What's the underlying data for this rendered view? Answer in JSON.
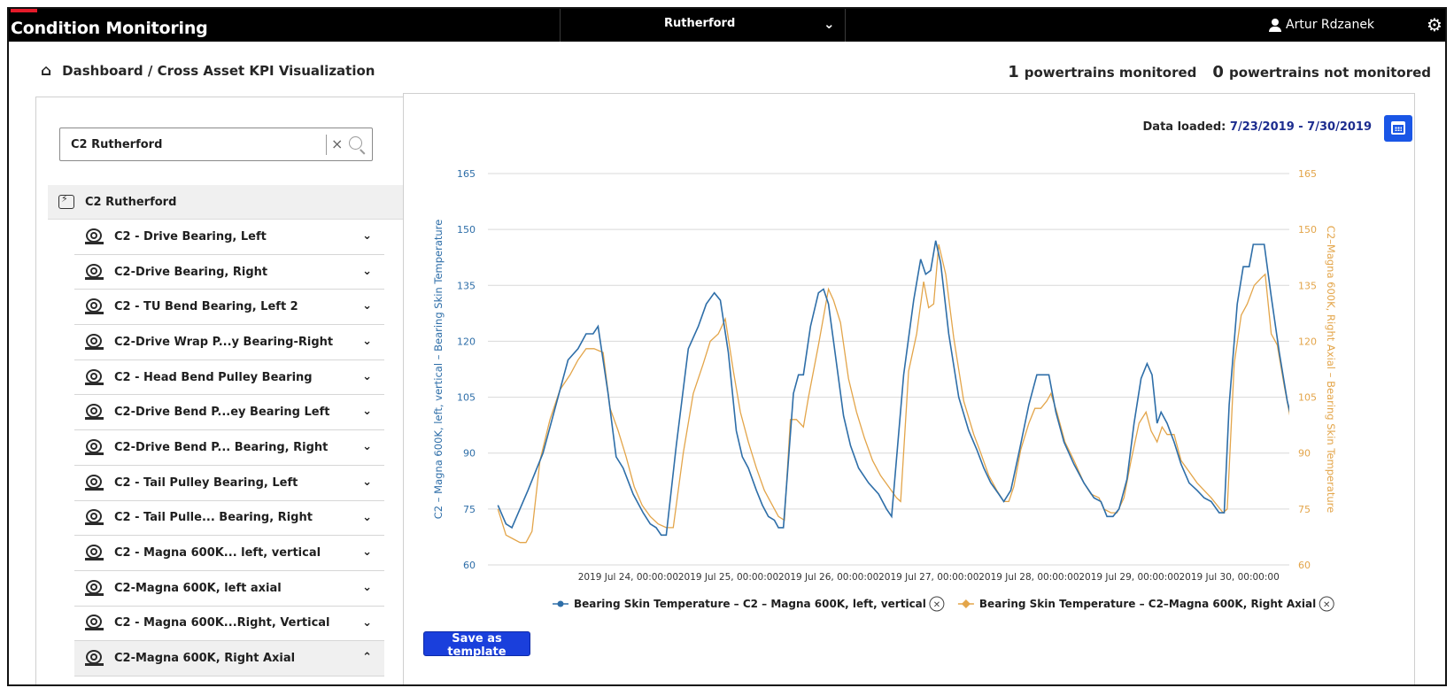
{
  "app": {
    "title": "Condition Monitoring",
    "site_selector": "Rutherford",
    "user_name": "Artur Rdzanek"
  },
  "breadcrumb": "Dashboard / Cross Asset KPI Visualization",
  "monitoring": {
    "monitored_count": "1",
    "monitored_label": "powertrains monitored",
    "not_monitored_count": "0",
    "not_monitored_label": "powertrains not monitored"
  },
  "sidebar": {
    "search_value": "C2 Rutherford",
    "root": "C2 Rutherford",
    "items": [
      {
        "label": "C2 - Drive Bearing, Left"
      },
      {
        "label": "C2-Drive Bearing, Right"
      },
      {
        "label": "C2 - TU Bend Bearing, Left 2"
      },
      {
        "label": "C2-Drive Wrap P...y Bearing-Right"
      },
      {
        "label": "C2 - Head Bend Pulley Bearing"
      },
      {
        "label": "C2-Drive Bend P...ey Bearing Left"
      },
      {
        "label": "C2-Drive Bend P... Bearing, Right"
      },
      {
        "label": "C2 - Tail Pulley Bearing, Left"
      },
      {
        "label": "C2 - Tail Pulle... Bearing, Right"
      },
      {
        "label": "C2 - Magna 600K... left, vertical"
      },
      {
        "label": "C2-Magna 600K, left axial"
      },
      {
        "label": "C2 - Magna 600K...Right, Vertical"
      },
      {
        "label": "C2-Magna 600K, Right Axial"
      }
    ]
  },
  "chart_panel": {
    "data_loaded_label": "Data loaded:",
    "data_loaded_range": "7/23/2019 - 7/30/2019",
    "save_label": "Save as template",
    "legend_remove_glyph": "✕"
  },
  "chart_data": {
    "type": "line",
    "ylabel_left": "C2 – Magna 600K, left, vertical – Bearing Skin Temperature",
    "ylabel_right": "C2–Magna 600K, Right Axial – Bearing Skin Temperature",
    "ylim": [
      60,
      165
    ],
    "yticks": [
      "60",
      "75",
      "90",
      "105",
      "120",
      "135",
      "150",
      "165"
    ],
    "xlim_days": [
      22.6,
      30.6
    ],
    "xticks": [
      {
        "t": 24,
        "label": "2019 Jul 24, 00:00:00"
      },
      {
        "t": 25,
        "label": "2019 Jul 25, 00:00:00"
      },
      {
        "t": 26,
        "label": "2019 Jul 26, 00:00:00"
      },
      {
        "t": 27,
        "label": "2019 Jul 27, 00:00:00"
      },
      {
        "t": 28,
        "label": "2019 Jul 28, 00:00:00"
      },
      {
        "t": 29,
        "label": "2019 Jul 29, 00:00:00"
      },
      {
        "t": 30,
        "label": "2019 Jul 30, 00:00:00"
      }
    ],
    "grid": true,
    "legend_position": "bottom",
    "series": [
      {
        "name": "Bearing Skin Temperature – C2 – Magna 600K, left, vertical",
        "color": "#2e6ea8",
        "axis": "left",
        "points": [
          [
            22.7,
            76
          ],
          [
            22.78,
            71
          ],
          [
            22.84,
            70
          ],
          [
            23.0,
            80
          ],
          [
            23.15,
            90
          ],
          [
            23.3,
            105
          ],
          [
            23.4,
            115
          ],
          [
            23.5,
            118
          ],
          [
            23.58,
            122
          ],
          [
            23.65,
            122
          ],
          [
            23.7,
            124
          ],
          [
            23.8,
            106
          ],
          [
            23.88,
            89
          ],
          [
            23.95,
            86
          ],
          [
            24.05,
            79
          ],
          [
            24.15,
            74
          ],
          [
            24.22,
            71
          ],
          [
            24.28,
            70
          ],
          [
            24.33,
            68
          ],
          [
            24.38,
            68
          ],
          [
            24.48,
            92
          ],
          [
            24.6,
            118
          ],
          [
            24.7,
            124
          ],
          [
            24.78,
            130
          ],
          [
            24.86,
            133
          ],
          [
            24.92,
            131
          ],
          [
            25.0,
            117
          ],
          [
            25.08,
            96
          ],
          [
            25.14,
            89
          ],
          [
            25.2,
            86
          ],
          [
            25.28,
            80
          ],
          [
            25.34,
            76
          ],
          [
            25.4,
            73
          ],
          [
            25.46,
            72
          ],
          [
            25.5,
            70
          ],
          [
            25.55,
            70
          ],
          [
            25.65,
            106
          ],
          [
            25.7,
            111
          ],
          [
            25.75,
            111
          ],
          [
            25.82,
            124
          ],
          [
            25.9,
            133
          ],
          [
            25.95,
            134
          ],
          [
            26.0,
            130
          ],
          [
            26.05,
            120
          ],
          [
            26.15,
            100
          ],
          [
            26.22,
            92
          ],
          [
            26.3,
            86
          ],
          [
            26.4,
            82
          ],
          [
            26.5,
            79
          ],
          [
            26.58,
            75
          ],
          [
            26.63,
            73
          ],
          [
            26.75,
            111
          ],
          [
            26.85,
            131
          ],
          [
            26.92,
            142
          ],
          [
            26.97,
            138
          ],
          [
            27.02,
            139
          ],
          [
            27.07,
            147
          ],
          [
            27.12,
            141
          ],
          [
            27.2,
            122
          ],
          [
            27.3,
            105
          ],
          [
            27.4,
            96
          ],
          [
            27.48,
            91
          ],
          [
            27.55,
            86
          ],
          [
            27.62,
            82
          ],
          [
            27.7,
            79
          ],
          [
            27.75,
            77
          ],
          [
            27.82,
            80
          ],
          [
            27.9,
            90
          ],
          [
            28.0,
            103
          ],
          [
            28.08,
            111
          ],
          [
            28.15,
            111
          ],
          [
            28.2,
            111
          ],
          [
            28.27,
            101
          ],
          [
            28.35,
            93
          ],
          [
            28.45,
            87
          ],
          [
            28.55,
            82
          ],
          [
            28.65,
            78
          ],
          [
            28.72,
            77
          ],
          [
            28.78,
            73
          ],
          [
            28.84,
            73
          ],
          [
            28.9,
            75
          ],
          [
            28.98,
            83
          ],
          [
            29.05,
            98
          ],
          [
            29.12,
            110
          ],
          [
            29.18,
            114
          ],
          [
            29.23,
            111
          ],
          [
            29.28,
            98
          ],
          [
            29.32,
            101
          ],
          [
            29.38,
            98
          ],
          [
            29.45,
            93
          ],
          [
            29.52,
            87
          ],
          [
            29.6,
            82
          ],
          [
            29.68,
            80
          ],
          [
            29.75,
            78
          ],
          [
            29.82,
            77
          ],
          [
            29.9,
            74
          ],
          [
            29.95,
            74
          ],
          [
            30.0,
            103
          ],
          [
            30.08,
            130
          ],
          [
            30.14,
            140
          ],
          [
            30.2,
            140
          ],
          [
            30.24,
            146
          ],
          [
            30.3,
            146
          ],
          [
            30.35,
            146
          ],
          [
            30.42,
            132
          ],
          [
            30.5,
            117
          ],
          [
            30.58,
            104
          ],
          [
            30.65,
            96
          ],
          [
            30.72,
            88
          ],
          [
            30.78,
            85
          ],
          [
            30.82,
            83
          ],
          [
            30.9,
            83
          ],
          [
            30.95,
            83
          ],
          [
            31.0,
            100
          ],
          [
            31.06,
            121
          ],
          [
            31.1,
            127
          ]
        ]
      },
      {
        "name": "Bearing Skin Temperature – C2–Magna 600K, Right Axial",
        "color": "#e3a54a",
        "axis": "right",
        "points": [
          [
            22.7,
            75
          ],
          [
            22.78,
            68
          ],
          [
            22.85,
            67
          ],
          [
            22.92,
            66
          ],
          [
            22.98,
            66
          ],
          [
            23.04,
            69
          ],
          [
            23.12,
            88
          ],
          [
            23.22,
            99
          ],
          [
            23.32,
            107
          ],
          [
            23.42,
            111
          ],
          [
            23.5,
            115
          ],
          [
            23.58,
            118
          ],
          [
            23.66,
            118
          ],
          [
            23.75,
            117
          ],
          [
            23.82,
            102
          ],
          [
            23.9,
            96
          ],
          [
            23.98,
            89
          ],
          [
            24.06,
            81
          ],
          [
            24.14,
            76
          ],
          [
            24.22,
            73
          ],
          [
            24.3,
            71
          ],
          [
            24.38,
            70
          ],
          [
            24.45,
            70
          ],
          [
            24.55,
            90
          ],
          [
            24.65,
            106
          ],
          [
            24.75,
            114
          ],
          [
            24.82,
            120
          ],
          [
            24.9,
            122
          ],
          [
            24.97,
            126
          ],
          [
            25.05,
            112
          ],
          [
            25.12,
            101
          ],
          [
            25.2,
            93
          ],
          [
            25.28,
            86
          ],
          [
            25.36,
            80
          ],
          [
            25.42,
            77
          ],
          [
            25.5,
            73
          ],
          [
            25.56,
            72
          ],
          [
            25.62,
            99
          ],
          [
            25.68,
            99
          ],
          [
            25.75,
            97
          ],
          [
            25.8,
            105
          ],
          [
            25.9,
            119
          ],
          [
            26.0,
            134
          ],
          [
            26.05,
            131
          ],
          [
            26.12,
            125
          ],
          [
            26.2,
            110
          ],
          [
            26.28,
            101
          ],
          [
            26.36,
            94
          ],
          [
            26.44,
            88
          ],
          [
            26.52,
            84
          ],
          [
            26.6,
            81
          ],
          [
            26.68,
            78
          ],
          [
            26.72,
            77
          ],
          [
            26.8,
            112
          ],
          [
            26.88,
            122
          ],
          [
            26.95,
            136
          ],
          [
            27.0,
            129
          ],
          [
            27.05,
            130
          ],
          [
            27.1,
            146
          ],
          [
            27.17,
            138
          ],
          [
            27.25,
            121
          ],
          [
            27.35,
            104
          ],
          [
            27.45,
            95
          ],
          [
            27.52,
            90
          ],
          [
            27.6,
            84
          ],
          [
            27.68,
            80
          ],
          [
            27.75,
            77
          ],
          [
            27.8,
            77
          ],
          [
            27.85,
            81
          ],
          [
            27.92,
            91
          ],
          [
            28.0,
            98
          ],
          [
            28.06,
            102
          ],
          [
            28.12,
            102
          ],
          [
            28.18,
            104
          ],
          [
            28.22,
            106
          ],
          [
            28.28,
            101
          ],
          [
            28.36,
            93
          ],
          [
            28.45,
            88
          ],
          [
            28.55,
            82
          ],
          [
            28.62,
            79
          ],
          [
            28.7,
            78
          ],
          [
            28.75,
            75
          ],
          [
            28.82,
            74
          ],
          [
            28.88,
            74
          ],
          [
            28.95,
            78
          ],
          [
            29.02,
            88
          ],
          [
            29.1,
            98
          ],
          [
            29.17,
            101
          ],
          [
            29.22,
            96
          ],
          [
            29.28,
            93
          ],
          [
            29.33,
            97
          ],
          [
            29.38,
            95
          ],
          [
            29.45,
            95
          ],
          [
            29.52,
            88
          ],
          [
            29.6,
            85
          ],
          [
            29.68,
            82
          ],
          [
            29.75,
            80
          ],
          [
            29.82,
            78
          ],
          [
            29.88,
            76
          ],
          [
            29.94,
            74
          ],
          [
            29.98,
            75
          ],
          [
            30.05,
            114
          ],
          [
            30.12,
            127
          ],
          [
            30.18,
            130
          ],
          [
            30.25,
            135
          ],
          [
            30.32,
            137
          ],
          [
            30.36,
            138
          ],
          [
            30.42,
            122
          ],
          [
            30.48,
            119
          ],
          [
            30.55,
            108
          ],
          [
            30.62,
            98
          ],
          [
            30.7,
            94
          ],
          [
            30.75,
            86
          ],
          [
            30.8,
            82
          ],
          [
            30.88,
            82
          ],
          [
            30.95,
            79
          ],
          [
            31.0,
            82
          ],
          [
            31.05,
            103
          ],
          [
            31.1,
            118
          ]
        ]
      }
    ]
  }
}
